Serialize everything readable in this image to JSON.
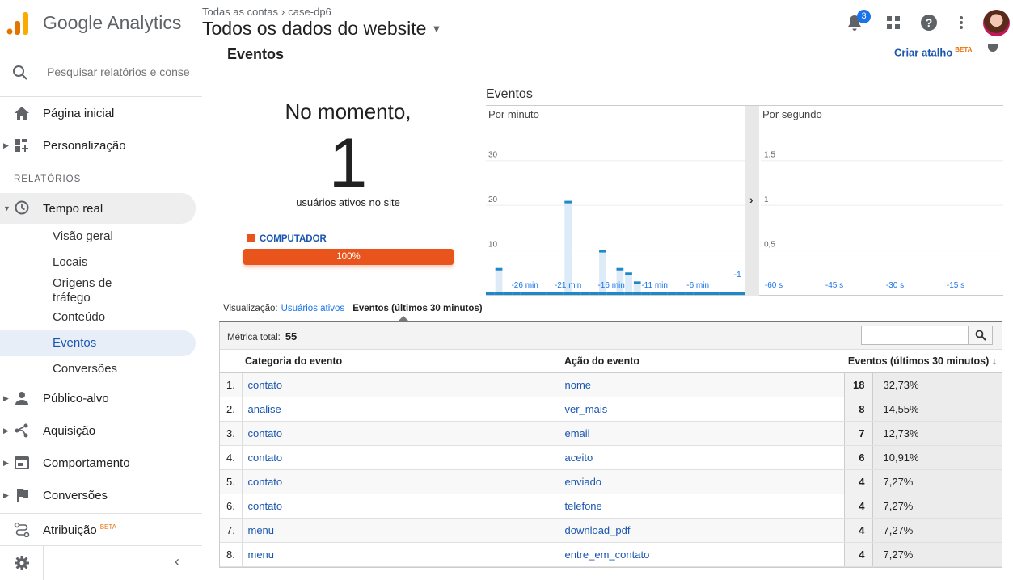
{
  "header": {
    "app_name": "Google Analytics",
    "breadcrumb": [
      "Todas as contas",
      "case-dp6"
    ],
    "view_name": "Todos os dados do website",
    "notifications_count": "3"
  },
  "sidebar": {
    "search_placeholder": "Pesquisar relatórios e conse",
    "home": "Página inicial",
    "customization": "Personalização",
    "reports_section": "RELATÓRIOS",
    "realtime": "Tempo real",
    "realtime_items": [
      "Visão geral",
      "Locais",
      "Origens de tráfego",
      "Conteúdo",
      "Eventos",
      "Conversões"
    ],
    "audience": "Público-alvo",
    "acquisition": "Aquisição",
    "behavior": "Comportamento",
    "conversions": "Conversões",
    "attribution": "Atribuição",
    "attribution_badge": "BETA"
  },
  "main": {
    "title": "Eventos",
    "shortcut": "Criar atalho",
    "shortcut_badge": "BETA",
    "now_label": "No momento,",
    "active_users": "1",
    "active_users_sub": "usuários ativos no site",
    "device_label": "COMPUTADOR",
    "device_pct": "100%",
    "charts_title": "Eventos",
    "per_minute_label": "Por minuto",
    "per_second_label": "Por segundo",
    "visualization_label": "Visualização:",
    "viz_link": "Usuários ativos",
    "viz_current": "Eventos (últimos 30 minutos)",
    "metric_total_label": "Métrica total:",
    "metric_total_value": "55"
  },
  "chart_data": [
    {
      "type": "bar",
      "title": "Por minuto",
      "x_ticks": [
        "-26 min",
        "-21 min",
        "-16 min",
        "-11 min",
        "-6 min",
        "-1"
      ],
      "y_ticks": [
        "10",
        "20",
        "30"
      ],
      "ylim": [
        0,
        35
      ],
      "x": [
        -30,
        -29,
        -28,
        -27,
        -26,
        -25,
        -24,
        -23,
        -22,
        -21,
        -20,
        -19,
        -18,
        -17,
        -16,
        -15,
        -14,
        -13,
        -12,
        -11,
        -10,
        -9,
        -8,
        -7,
        -6,
        -5,
        -4,
        -3,
        -2,
        -1
      ],
      "values": [
        0,
        6,
        0,
        0,
        0,
        0,
        0,
        0,
        0,
        21,
        0,
        0,
        0,
        10,
        0,
        6,
        5,
        3,
        0,
        0,
        0,
        0,
        0,
        0,
        0,
        0,
        0,
        0,
        0,
        0
      ]
    },
    {
      "type": "bar",
      "title": "Por segundo",
      "x_ticks": [
        "-60 s",
        "-45 s",
        "-30 s",
        "-15 s"
      ],
      "y_ticks": [
        "0,5",
        "1",
        "1,5"
      ],
      "ylim": [
        0,
        1.75
      ],
      "values": []
    }
  ],
  "table": {
    "headers": [
      "Categoria do evento",
      "Ação do evento",
      "Eventos (últimos 30 minutos)"
    ],
    "rows": [
      {
        "idx": "1.",
        "cat": "contato",
        "act": "nome",
        "num": "18",
        "pct": "32,73%"
      },
      {
        "idx": "2.",
        "cat": "analise",
        "act": "ver_mais",
        "num": "8",
        "pct": "14,55%"
      },
      {
        "idx": "3.",
        "cat": "contato",
        "act": "email",
        "num": "7",
        "pct": "12,73%"
      },
      {
        "idx": "4.",
        "cat": "contato",
        "act": "aceito",
        "num": "6",
        "pct": "10,91%"
      },
      {
        "idx": "5.",
        "cat": "contato",
        "act": "enviado",
        "num": "4",
        "pct": "7,27%"
      },
      {
        "idx": "6.",
        "cat": "contato",
        "act": "telefone",
        "num": "4",
        "pct": "7,27%"
      },
      {
        "idx": "7.",
        "cat": "menu",
        "act": "download_pdf",
        "num": "4",
        "pct": "7,27%"
      },
      {
        "idx": "8.",
        "cat": "menu",
        "act": "entre_em_contato",
        "num": "4",
        "pct": "7,27%"
      }
    ]
  },
  "colors": {
    "accent": "#1a56b0",
    "device": "#e8541c",
    "bar": "#1e88c8",
    "bar_bg": "#dcebf7"
  }
}
